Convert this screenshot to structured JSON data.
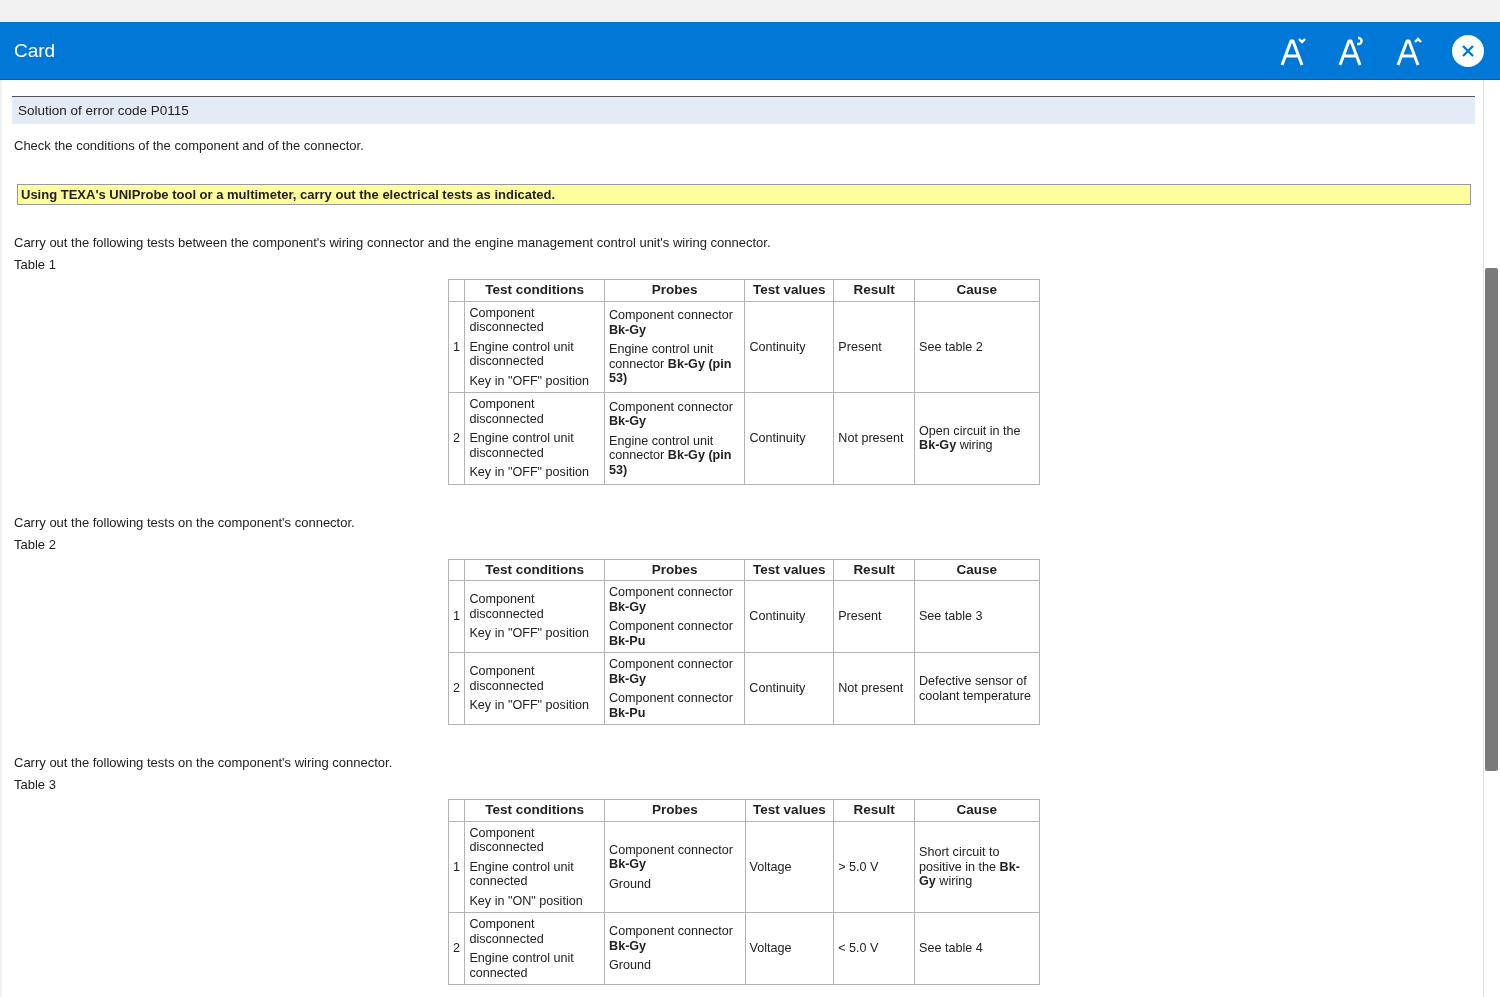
{
  "window": {
    "title": "Card"
  },
  "heading": "Solution of error code P0115",
  "intro": "Check the conditions of the component and of the connector.",
  "note": "Using TEXA's UNIProbe tool or a multimeter, carry out the electrical tests as indicated.",
  "sections": [
    {
      "text": "Carry out the following tests between the component's wiring connector and the engine management control unit's wiring connector.",
      "caption": "Table 1",
      "columns": [
        "Test conditions",
        "Probes",
        "Test values",
        "Result",
        "Cause"
      ],
      "rows": [
        {
          "number": "1",
          "conditions": [
            "Component disconnected",
            "Engine control unit disconnected",
            "Key in \"OFF\" position"
          ],
          "probes": [
            "Component connector **Bk-Gy**",
            "Engine control unit connector **Bk-Gy (pin 53)**"
          ],
          "test_value": "Continuity",
          "result": "Present",
          "cause": "See table 2"
        },
        {
          "number": "2",
          "conditions": [
            "Component disconnected",
            "Engine control unit disconnected",
            "Key in \"OFF\" position"
          ],
          "probes": [
            "Component connector **Bk-Gy**",
            "Engine control unit connector **Bk-Gy (pin 53)**"
          ],
          "test_value": "Continuity",
          "result": "Not present",
          "cause": "Open circuit in the **Bk-Gy** wiring"
        }
      ]
    },
    {
      "text": "Carry out the following tests on the component's connector.",
      "caption": "Table 2",
      "columns": [
        "Test conditions",
        "Probes",
        "Test values",
        "Result",
        "Cause"
      ],
      "rows": [
        {
          "number": "1",
          "conditions": [
            "Component disconnected",
            "Key in \"OFF\" position"
          ],
          "probes": [
            "Component connector **Bk-Gy**",
            "Component connector **Bk-Pu**"
          ],
          "test_value": "Continuity",
          "result": "Present",
          "cause": "See table 3"
        },
        {
          "number": "2",
          "conditions": [
            "Component disconnected",
            "Key in \"OFF\" position"
          ],
          "probes": [
            "Component connector **Bk-Gy**",
            "Component connector **Bk-Pu**"
          ],
          "test_value": "Continuity",
          "result": "Not present",
          "cause": "Defective sensor of coolant temperature"
        }
      ]
    },
    {
      "text": "Carry out the following tests on the component's wiring connector.",
      "caption": "Table 3",
      "columns": [
        "Test conditions",
        "Probes",
        "Test values",
        "Result",
        "Cause"
      ],
      "rows": [
        {
          "number": "1",
          "conditions": [
            "Component disconnected",
            "Engine control unit connected",
            "Key in \"ON\" position"
          ],
          "probes": [
            "Component connector **Bk-Gy**",
            "Ground"
          ],
          "test_value": "Voltage",
          "result": "> 5.0 V",
          "cause": "Short circuit to positive in the **Bk-Gy** wiring"
        },
        {
          "number": "2",
          "conditions": [
            "Component disconnected",
            "Engine control unit connected"
          ],
          "probes": [
            "Component connector **Bk-Gy**",
            "Ground"
          ],
          "test_value": "Voltage",
          "result": "< 5.0 V",
          "cause": "See table 4"
        }
      ]
    }
  ]
}
